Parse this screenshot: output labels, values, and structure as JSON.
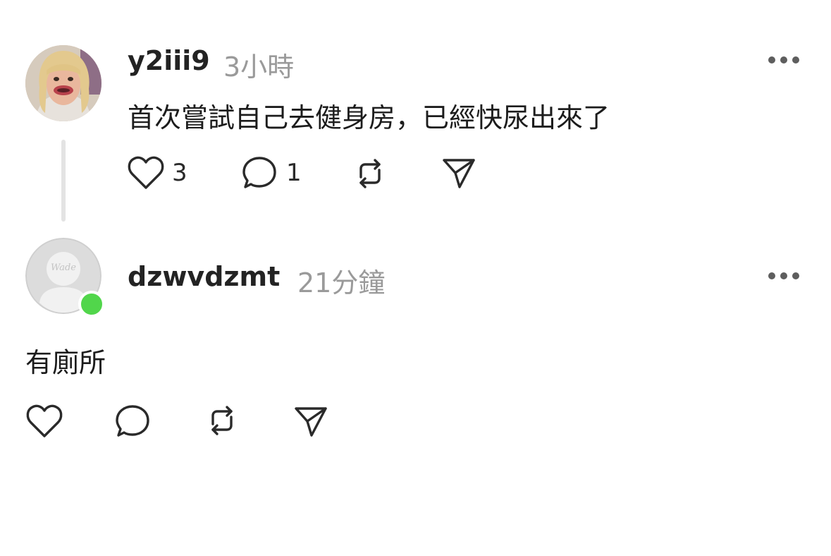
{
  "posts": [
    {
      "username": "y2iii9",
      "time": "3小時",
      "text": "首次嘗試自己去健身房，已經快尿出來了",
      "likes": "3",
      "replies": "1",
      "avatar_icon": "girl-face-avatar"
    },
    {
      "username": "dzwvdzmt",
      "time": "21分鐘",
      "text": "有廁所",
      "avatar_badge": "Wade",
      "online_color": "#51d64b",
      "avatar_icon": "default-avatar"
    }
  ],
  "icons": {
    "like": "heart-icon",
    "reply": "comment-icon",
    "repost": "repost-icon",
    "share": "send-icon",
    "more": "more-dots-icon"
  }
}
